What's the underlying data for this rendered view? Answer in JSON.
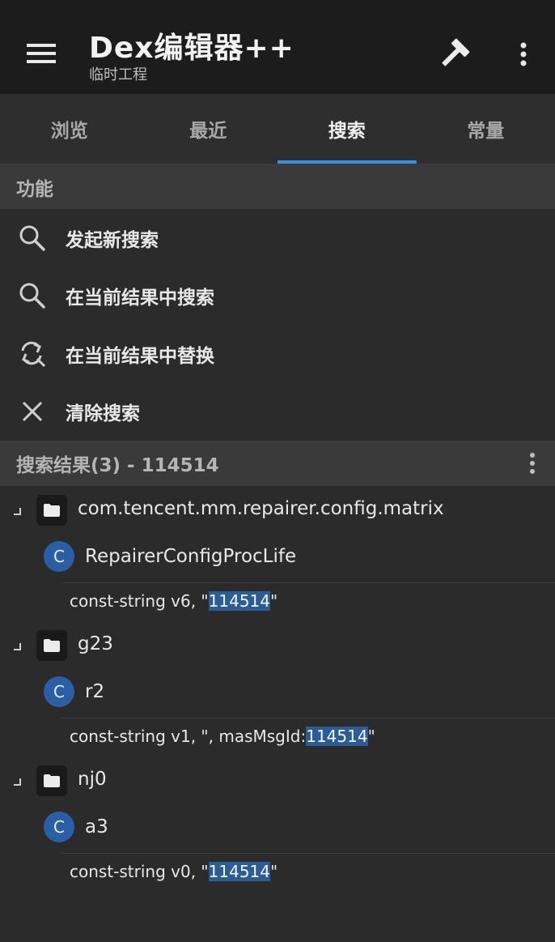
{
  "appbar": {
    "title": "Dex编辑器++",
    "subtitle": "临时工程",
    "menu_icon": "hamburger-menu-icon",
    "build_icon": "hammer-icon",
    "more_icon": "vertical-dots-icon"
  },
  "tabs": [
    {
      "label": "浏览"
    },
    {
      "label": "最近"
    },
    {
      "label": "搜索",
      "active": true
    },
    {
      "label": "常量"
    }
  ],
  "functions": {
    "header": "功能",
    "items": [
      {
        "label": "发起新搜索",
        "icon": "search-icon"
      },
      {
        "label": "在当前结果中搜索",
        "icon": "search-icon"
      },
      {
        "label": "在当前结果中替换",
        "icon": "replace-icon"
      },
      {
        "label": "清除搜索",
        "icon": "close-icon"
      }
    ]
  },
  "results": {
    "header": "搜索结果(3) - 114514",
    "groups": [
      {
        "package": "com.tencent.mm.repairer.config.matrix",
        "class_badge": "C",
        "class": "RepairerConfigProcLife",
        "code_prefix": "const-string v6, \"",
        "code_match": "114514",
        "code_suffix": "\""
      },
      {
        "package": "g23",
        "class_badge": "C",
        "class": "r2",
        "code_prefix": "const-string v1, \", masMsgId:",
        "code_match": "114514",
        "code_suffix": "\""
      },
      {
        "package": "nj0",
        "class_badge": "C",
        "class": "a3",
        "code_prefix": "const-string v0, \"",
        "code_match": "114514",
        "code_suffix": "\""
      }
    ]
  },
  "colors": {
    "accent": "#3b8fd6",
    "highlight": "#2c5c94",
    "class_badge": "#2a5fa6"
  }
}
